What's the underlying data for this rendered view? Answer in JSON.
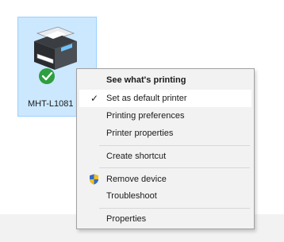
{
  "printer": {
    "label": "MHT-L1081"
  },
  "menu": {
    "see_whats_printing": "See what's printing",
    "set_default": "Set as default printer",
    "printing_preferences": "Printing preferences",
    "printer_properties": "Printer properties",
    "create_shortcut": "Create shortcut",
    "remove_device": "Remove device",
    "troubleshoot": "Troubleshoot",
    "properties": "Properties",
    "check_glyph": "✓"
  },
  "icons": {
    "printer": "printer-icon",
    "default_badge": "green-check-badge-icon",
    "shield": "uac-shield-icon",
    "check": "checkmark-icon"
  },
  "colors": {
    "selection_fill": "#cce8ff",
    "selection_border": "#99d1ff",
    "menu_background": "#f2f2f2",
    "badge_green": "#2e9e3f"
  }
}
